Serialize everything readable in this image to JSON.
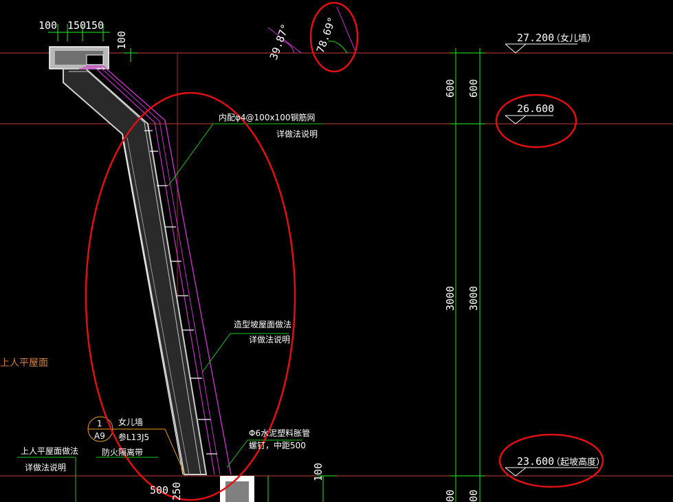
{
  "drawing": {
    "dims_top": {
      "a": "100",
      "b": "150",
      "c": "150"
    },
    "dim_side_top": "100",
    "angle_left": "39.87°",
    "angle_right": "78.69°",
    "elevations": {
      "top": {
        "value": "27.200",
        "note": "（女儿墙）"
      },
      "mid": {
        "value": "26.600"
      },
      "start": {
        "value": "23.600",
        "note": "（起坡高度）"
      }
    },
    "vertical_dims": {
      "top_a": "600",
      "top_b": "600",
      "main_a": "3000",
      "main_b": "3000",
      "low": "100",
      "bottom_a": "00",
      "bottom_b": "00"
    },
    "notes": {
      "mesh_line1": "内配φ4@100x100钢筋网",
      "mesh_line2": "详做法说明",
      "slope_line1": "造型坡屋面做法",
      "slope_line2": "详做法说明",
      "pipe_line1": "Φ6水泥塑料胀管",
      "pipe_line2": "螺钉，中距500",
      "parapet_num": "1",
      "parapet_sheet": "A9",
      "parapet_title": "女儿墙",
      "parapet_ref": "参L13J5",
      "fire_belt": "防火隔离带",
      "roof_left": "上人平屋面",
      "roof_method_1": "上人平屋面做法",
      "roof_method_2": "详做法说明"
    },
    "bottom_dims": {
      "a": "500",
      "b": "250"
    },
    "colors": {
      "ink": "#ffffff",
      "red_line": "#c83c3c",
      "leader": "#18c818",
      "hatch": "#c8c8c8",
      "magenta": "#c832c8",
      "annotation": "#e01010"
    }
  }
}
